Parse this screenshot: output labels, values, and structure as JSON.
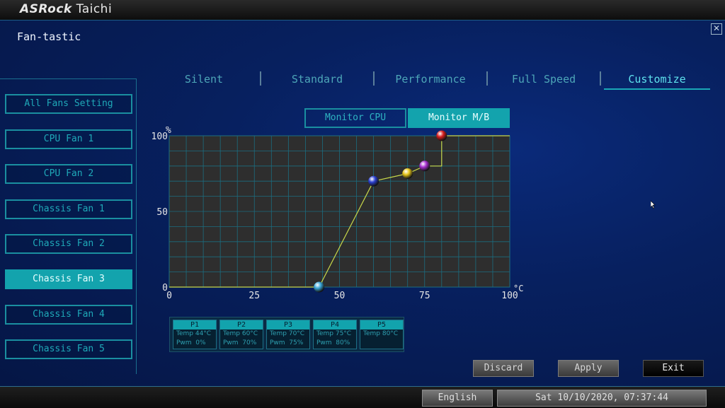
{
  "brand": {
    "name_bold": "ASRock",
    "name_rest": "Taichi"
  },
  "window": {
    "title": "Fan-tastic",
    "close_symbol": "✕"
  },
  "tabs": [
    {
      "label": "Silent",
      "active": false
    },
    {
      "label": "Standard",
      "active": false
    },
    {
      "label": "Performance",
      "active": false
    },
    {
      "label": "Full Speed",
      "active": false
    },
    {
      "label": "Customize",
      "active": true
    }
  ],
  "sidebar": {
    "items": [
      {
        "label": "All Fans Setting"
      },
      {
        "label": "CPU Fan 1"
      },
      {
        "label": "CPU Fan 2"
      },
      {
        "label": "Chassis Fan 1"
      },
      {
        "label": "Chassis Fan 2"
      },
      {
        "label": "Chassis Fan 3",
        "selected": true
      },
      {
        "label": "Chassis Fan 4"
      },
      {
        "label": "Chassis Fan 5"
      }
    ]
  },
  "monitor": {
    "cpu_label": "Monitor CPU",
    "mb_label": "Monitor M/B",
    "active": "mb"
  },
  "chart_data": {
    "type": "line",
    "x_unit": "°C",
    "y_unit": "%",
    "x_ticks": [
      "0",
      "25",
      "50",
      "75",
      "100"
    ],
    "y_ticks": [
      "100",
      "50",
      "0"
    ],
    "xlim": [
      0,
      100
    ],
    "ylim": [
      0,
      100
    ],
    "grid": true,
    "series": [
      {
        "x": [
          0,
          44,
          60,
          70,
          75,
          80,
          80,
          100
        ],
        "y": [
          0,
          0,
          70,
          75,
          80,
          80,
          100,
          100
        ],
        "color": "#c8d84a"
      }
    ],
    "points": [
      {
        "label": "P1",
        "temp": 44,
        "pwm": 0,
        "color": "#3aa7d8"
      },
      {
        "label": "P2",
        "temp": 60,
        "pwm": 70,
        "color": "#2a3fd0"
      },
      {
        "label": "P3",
        "temp": 70,
        "pwm": 75,
        "color": "#e6c417"
      },
      {
        "label": "P4",
        "temp": 75,
        "pwm": 80,
        "color": "#a62fd0"
      },
      {
        "label": "P5",
        "temp": 80,
        "pwm": 100,
        "color": "#d81e1e"
      }
    ]
  },
  "point_table": [
    {
      "name": "P1",
      "temp_line": "Temp 44°C",
      "pwm_line": "Pwm  0%"
    },
    {
      "name": "P2",
      "temp_line": "Temp 60°C",
      "pwm_line": "Pwm  70%"
    },
    {
      "name": "P3",
      "temp_line": "Temp 70°C",
      "pwm_line": "Pwm  75%"
    },
    {
      "name": "P4",
      "temp_line": "Temp 75°C",
      "pwm_line": "Pwm  80%"
    },
    {
      "name": "P5",
      "temp_line": "Temp 80°C",
      "pwm_line": ""
    }
  ],
  "actions": {
    "discard": "Discard",
    "apply": "Apply",
    "exit": "Exit"
  },
  "statusbar": {
    "language": "English",
    "datetime": "Sat 10/10/2020, 07:37:44"
  }
}
